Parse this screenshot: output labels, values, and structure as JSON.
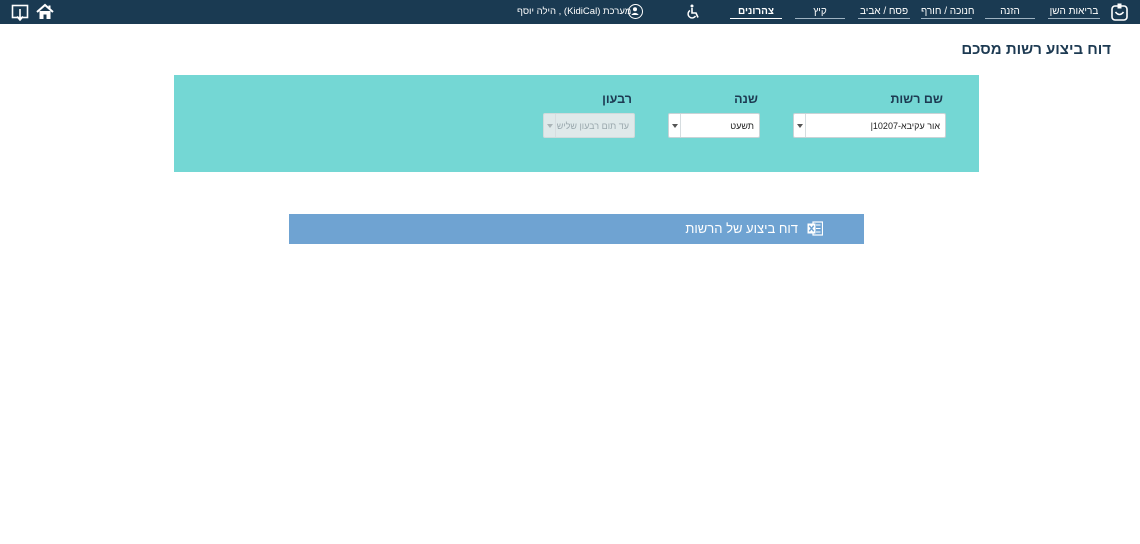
{
  "topbar": {
    "nav": {
      "briut": "בריאות השן",
      "hazana": "הזנה",
      "hanuka": "חנוכה / חורף",
      "pesach": "פסח / אביב",
      "kayitz": "קיץ",
      "tzaharonim": "צהרונים"
    },
    "user": "מערכת (KidiCal) , הילה יוסף",
    "icons": [
      "app-logo-icon",
      "accessibility-icon",
      "user-icon",
      "home-icon",
      "logout-icon"
    ]
  },
  "page": {
    "title": "דוח ביצוע רשות מסכם"
  },
  "filters": {
    "authority": {
      "label": "שם רשות",
      "value": "אור עקיבא-10207|"
    },
    "year": {
      "label": "שנה",
      "value": "תשעט"
    },
    "quarter": {
      "label": "רבעון",
      "value": "עד תום רבעון שלישי"
    }
  },
  "report": {
    "label": "דוח ביצוע של הרשות",
    "icon": "excel-icon"
  },
  "colors": {
    "topbar": "#1a3a52",
    "panel": "#74d7d4",
    "button": "#6fa3d2"
  }
}
